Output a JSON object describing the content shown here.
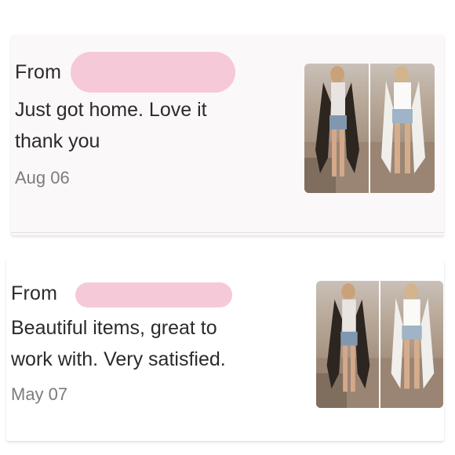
{
  "reviews": [
    {
      "from_label": "From",
      "message_line1": "Just got home. Love it",
      "message_line2": "thank you",
      "date": "Aug 06",
      "thumbnail": "product-photo-kimono-cardigan"
    },
    {
      "from_label": "From",
      "message_line1": "Beautiful items, great to",
      "message_line2": "work with. Very satisfied.",
      "date": "May 07",
      "thumbnail": "product-photo-kimono-cardigan"
    }
  ],
  "colors": {
    "redaction": "#f6c9d8",
    "text": "#2b2b2b",
    "date": "#7c7c7c"
  }
}
